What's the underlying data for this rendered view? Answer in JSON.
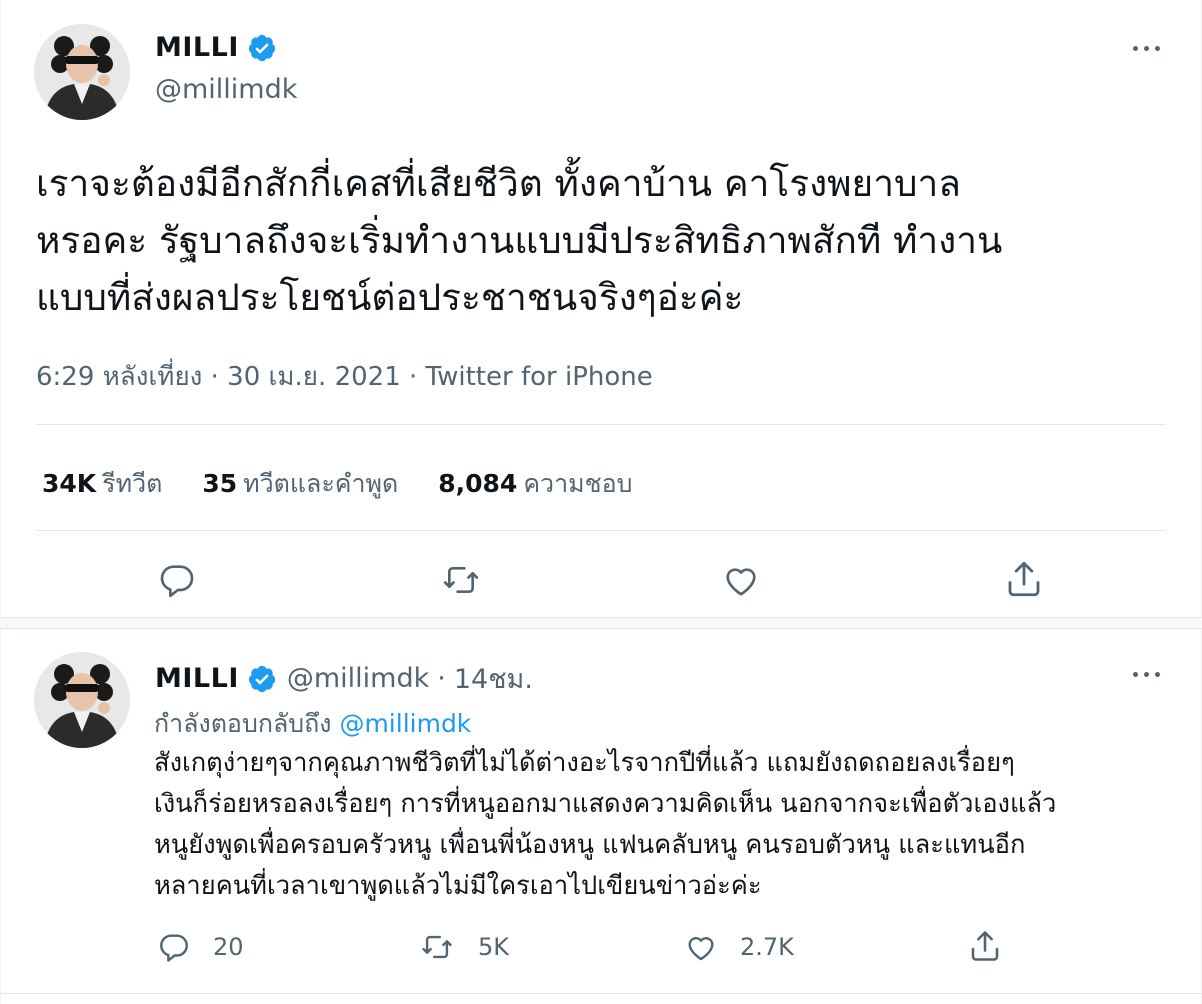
{
  "colors": {
    "accent": "#1d9bf0",
    "secondary_text": "#536471",
    "primary_text": "#0f1419"
  },
  "main_tweet": {
    "author": {
      "name": "MILLI",
      "handle": "@millimdk",
      "verified": true
    },
    "text_lines": [
      "เราจะต้องมีอีกสักกี่เคสที่เสียชีวิต ทั้งคาบ้าน คาโรงพยาบาล",
      "หรอคะ รัฐบาลถึงจะเริ่มทำงานแบบมีประสิทธิภาพสักที ทำงาน",
      "แบบที่ส่งผลประโยชน์ต่อประชาชนจริงๆอ่ะค่ะ"
    ],
    "time": "6:29 หลังเที่ยง",
    "separator": "·",
    "date": "30 เม.ย. 2021",
    "source": "Twitter for iPhone",
    "stats": {
      "retweets_value": "34K",
      "retweets_label": "รีทวีต",
      "quotes_value": "35",
      "quotes_label": "ทวีตและคำพูด",
      "likes_value": "8,084",
      "likes_label": "ความชอบ"
    },
    "actions": [
      "reply-icon",
      "retweet-icon",
      "like-icon",
      "share-icon"
    ]
  },
  "reply_tweet": {
    "author": {
      "name": "MILLI",
      "handle": "@millimdk",
      "verified": true,
      "time": "14ชม."
    },
    "separator": "·",
    "replying_to_label": "กำลังตอบกลับถึง",
    "replying_to_handle": "@millimdk",
    "text_lines": [
      "สังเกตุง่ายๆจากคุณภาพชีวิตที่ไม่ได้ต่างอะไรจากปีที่แล้ว แถมยังถดถอยลงเรื่อยๆ",
      "เงินก็ร่อยหรอลงเรื่อยๆ การที่หนูออกมาแสดงความคิดเห็น นอกจากจะเพื่อตัวเองแล้ว",
      "หนูยังพูดเพื่อครอบครัวหนู เพื่อนพี่น้องหนู แฟนคลับหนู คนรอบตัวหนู และแทนอีก",
      "หลายคนที่เวลาเขาพูดแล้วไม่มีใครเอาไปเขียนข่าวอ่ะค่ะ"
    ],
    "counts": {
      "replies": "20",
      "retweets": "5K",
      "likes": "2.7K"
    }
  }
}
